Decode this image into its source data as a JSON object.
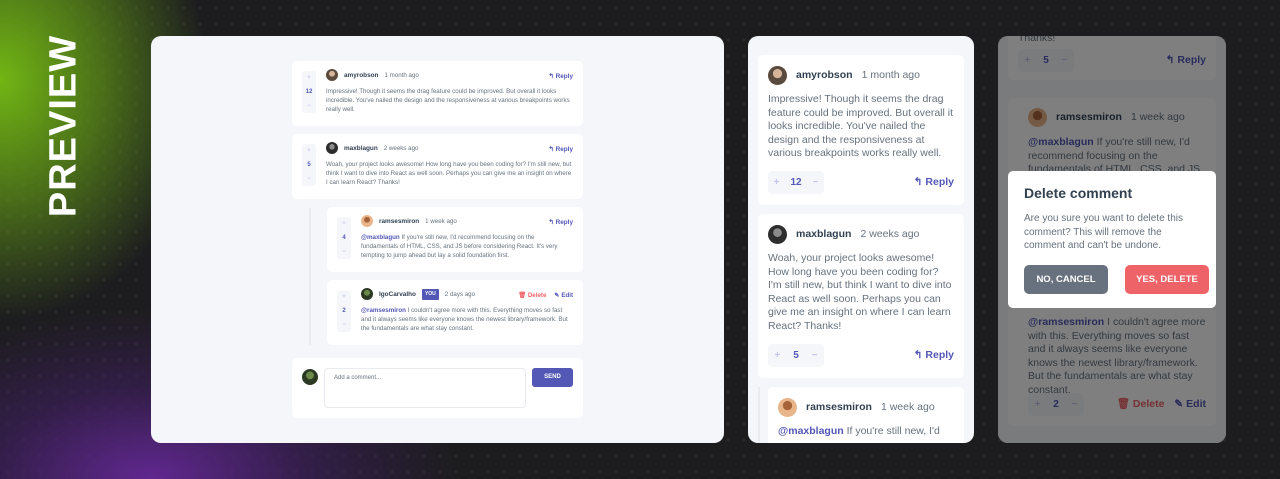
{
  "preview_label": "PREVIEW",
  "panel_desktop": {
    "comments": [
      {
        "user": "amyrobson",
        "date": "1 month ago",
        "score": "12",
        "reply": "Reply",
        "text": "Impressive! Though it seems the drag feature could be improved. But overall it looks incredible. You've nailed the design and the responsiveness at various breakpoints works really well."
      },
      {
        "user": "maxblagun",
        "date": "2 weeks ago",
        "score": "5",
        "reply": "Reply",
        "text": "Woah, your project looks awesome! How long have you been coding for? I'm still new, but think I want to dive into React as well soon. Perhaps you can give me an insight on where I can learn React? Thanks!"
      }
    ],
    "replies": [
      {
        "user": "ramsesmiron",
        "date": "1 week ago",
        "score": "4",
        "reply": "Reply",
        "mention": "@maxblagun",
        "text": "If you're still new, I'd recommend focusing on the fundamentals of HTML, CSS, and JS before considering React. It's very tempting to jump ahead but lay a solid foundation first."
      },
      {
        "user": "IgoCarvalho",
        "you": "YOU",
        "date": "2 days ago",
        "score": "2",
        "delete": "Delete",
        "edit": "Edit",
        "mention": "@ramsesmiron",
        "text": "I couldn't agree more with this. Everything moves so fast and it always seems like everyone knows the newest library/framework. But the fundamentals are what stay constant."
      }
    ],
    "add_comment": {
      "placeholder": "Add a comment...",
      "send": "SEND"
    }
  },
  "panel_mobile": {
    "comments": [
      {
        "user": "amyrobson",
        "date": "1 month ago",
        "score": "12",
        "reply": "Reply",
        "text": "Impressive! Though it seems the drag feature could be improved. But overall it looks incredible. You've nailed the design and the responsiveness at various breakpoints works really well."
      },
      {
        "user": "maxblagun",
        "date": "2 weeks ago",
        "score": "5",
        "reply": "Reply",
        "text": "Woah, your project looks awesome! How long have you been coding for? I'm still new, but think I want to dive into React as well soon. Perhaps you can give me an insight on where I can learn React? Thanks!"
      }
    ],
    "reply": {
      "user": "ramsesmiron",
      "date": "1 week ago",
      "mention": "@maxblagun",
      "text": "If you're still new, I'd"
    }
  },
  "panel_modal": {
    "top_text": "Thanks!",
    "top_score": "5",
    "top_reply": "Reply",
    "reply_user": "ramsesmiron",
    "reply_date": "1 week ago",
    "reply_mention": "@maxblagun",
    "reply_text": "If you're still new, I'd recommend focusing on the fundamentals of HTML, CSS, and JS",
    "bottom_mention": "@ramsesmiron",
    "bottom_text": "I couldn't agree more with this. Everything moves so fast and it always seems like everyone knows the newest library/framework. But the fundamentals are what stay constant.",
    "bottom_score": "2",
    "bottom_delete": "Delete",
    "bottom_edit": "Edit",
    "modal": {
      "title": "Delete comment",
      "text": "Are you sure you want to delete this comment? This will remove the comment and can't be undone.",
      "cancel": "NO, CANCEL",
      "confirm": "YES, DELETE"
    }
  },
  "colors": {
    "primary": "#5357b6",
    "danger": "#ed6368",
    "neutral": "#67727e",
    "dark": "#324152"
  }
}
